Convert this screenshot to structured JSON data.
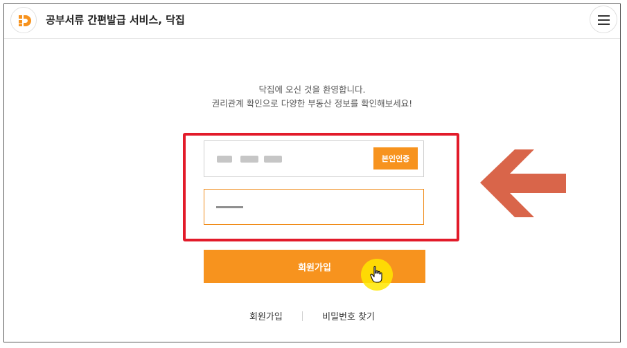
{
  "header": {
    "app_title": "공부서류 간편발급 서비스, 닥집",
    "logo_icon": "dakjip-logo-icon",
    "menu_icon": "hamburger-menu-icon"
  },
  "welcome": {
    "line1": "닥집에 오신 것을 환영합니다.",
    "line2": "권리관계 확인으로 다양한 부동산 정보를 확인해보세요!"
  },
  "form": {
    "phone_value_masked": true,
    "verify_button_label": "본인인증",
    "password_value_masked": true
  },
  "signup_button_label": "회원가입",
  "links": {
    "signup": "회원가입",
    "find_password": "비밀번호 찾기"
  },
  "colors": {
    "accent": "#f7931e",
    "highlight_border": "#e21b2a",
    "arrow": "#d9654a",
    "cursor_highlight": "#ffe600"
  }
}
